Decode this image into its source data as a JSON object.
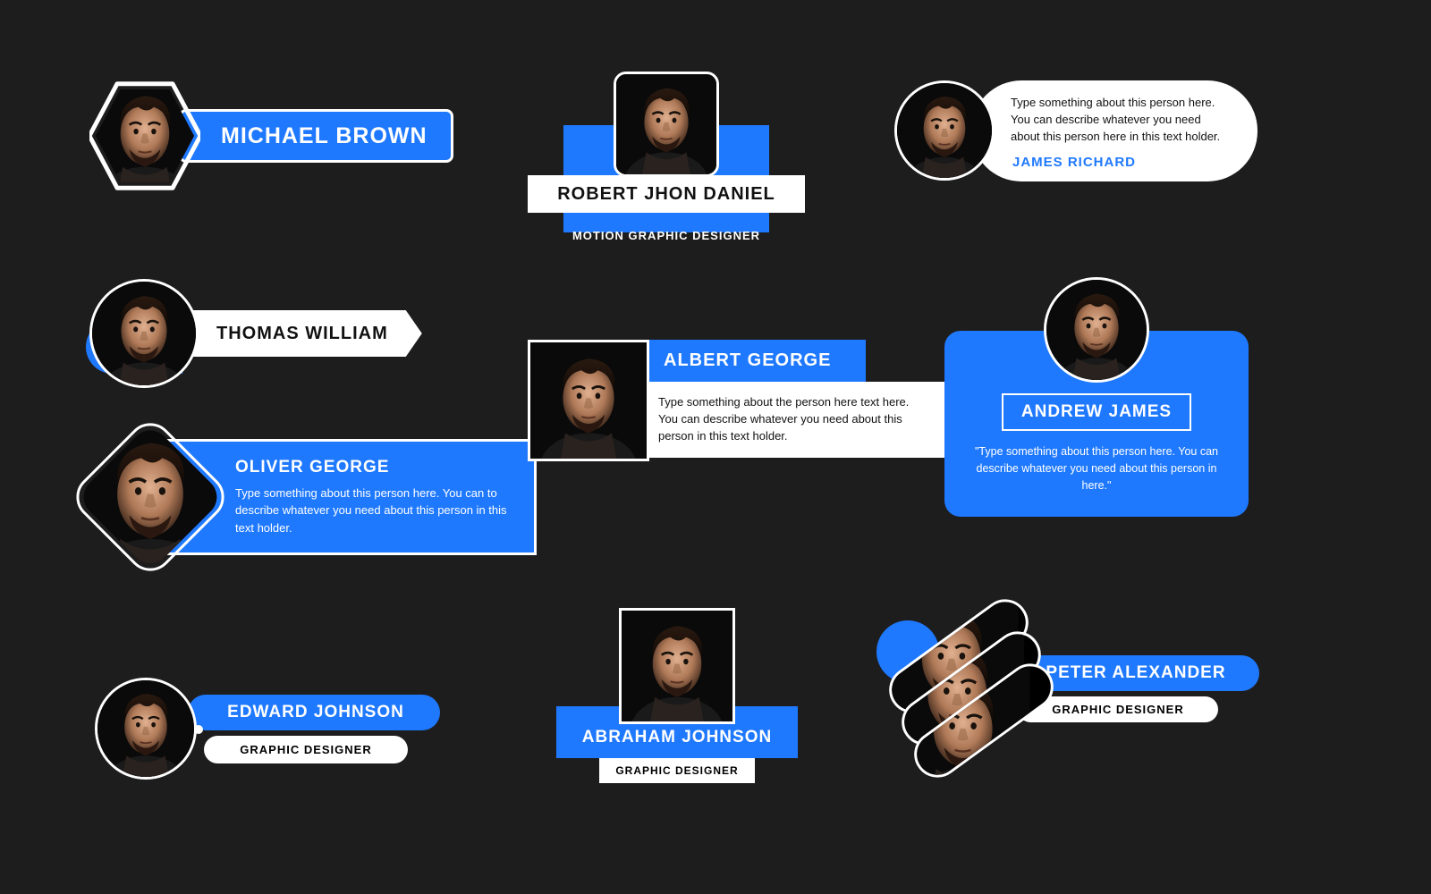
{
  "colors": {
    "accent": "#1f79ff",
    "bg": "#1d1d1d"
  },
  "cards": {
    "michael": {
      "name": "MICHAEL BROWN"
    },
    "robert": {
      "name": "ROBERT JHON DANIEL",
      "sub": "MOTION GRAPHIC DESIGNER"
    },
    "james": {
      "name": "JAMES RICHARD",
      "desc": "Type something about this person here. You can describe whatever you need about this person here in this text holder."
    },
    "thomas": {
      "name": "THOMAS WILLIAM"
    },
    "oliver": {
      "name": "OLIVER GEORGE",
      "desc": "Type something about this person here. You can to describe whatever you need about this person in this text holder."
    },
    "albert": {
      "name": "ALBERT GEORGE",
      "desc": "Type something about the person here text here. You can describe whatever you need about this person in this text holder."
    },
    "andrew": {
      "name": "ANDREW JAMES",
      "quote": "\"Type something about this person here. You can describe whatever you need about this person in here.\""
    },
    "edward": {
      "name": "EDWARD JOHNSON",
      "sub": "GRAPHIC DESIGNER"
    },
    "abraham": {
      "name": "ABRAHAM JOHNSON",
      "sub": "GRAPHIC DESIGNER"
    },
    "peter": {
      "name": "PETER ALEXANDER",
      "sub": "GRAPHIC DESIGNER"
    }
  }
}
